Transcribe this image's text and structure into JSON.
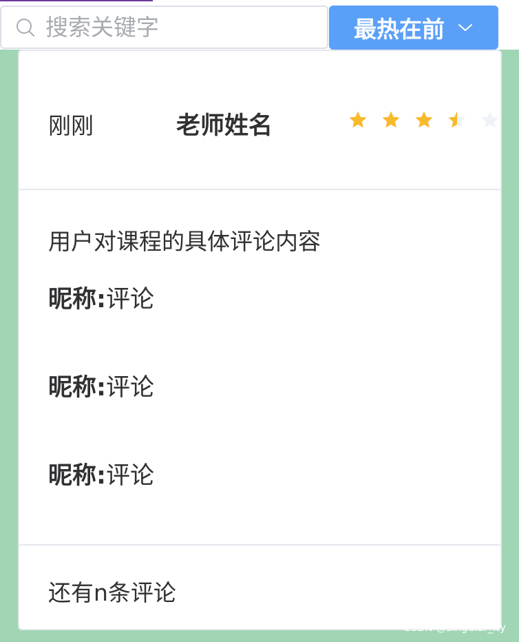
{
  "search": {
    "placeholder": "搜索关键字",
    "value": ""
  },
  "sort": {
    "selected": "最热在前"
  },
  "comment_card": {
    "time": "刚刚",
    "teacher_name": "老师姓名",
    "rating": {
      "value": 3.5,
      "max": 5
    },
    "content": "用户对课程的具体评论内容",
    "replies": [
      {
        "nickname": "昵称:",
        "text": "评论"
      },
      {
        "nickname": "昵称:",
        "text": "评论"
      },
      {
        "nickname": "昵称:",
        "text": "评论"
      }
    ],
    "more_label": "还有n条评论"
  },
  "watermark": "CSDN @singular_ity",
  "colors": {
    "background": "#a0d6b4",
    "primary": "#5ba0f8",
    "star_active": "#f7ba2a",
    "star_inactive": "#eff2f7",
    "border": "#e4e7ed"
  },
  "icons": {
    "search": "search-icon",
    "dropdown": "chevron-down-icon",
    "star": "star-icon"
  }
}
